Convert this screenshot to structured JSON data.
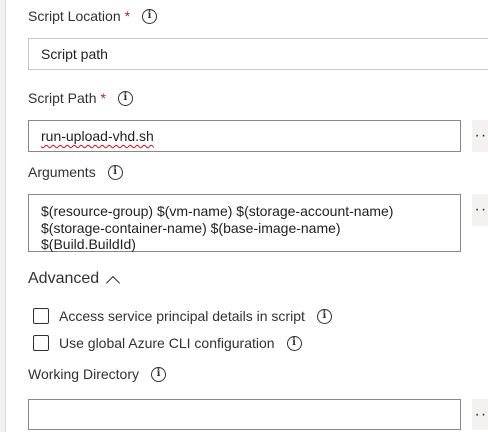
{
  "script_location": {
    "label": "Script Location",
    "required_mark": "*",
    "value": "Script path"
  },
  "script_path": {
    "label": "Script Path",
    "required_mark": "*",
    "value": "run-upload-vhd.sh"
  },
  "arguments": {
    "label": "Arguments",
    "value": "$(resource-group) $(vm-name) $(storage-account-name)\n$(storage-container-name) $(base-image-name)\n$(Build.BuildId)"
  },
  "advanced": {
    "label": "Advanced",
    "options": [
      {
        "label": "Access service principal details in script",
        "checked": false
      },
      {
        "label": "Use global Azure CLI configuration",
        "checked": false
      }
    ]
  },
  "working_directory": {
    "label": "Working Directory",
    "value": ""
  },
  "icons": {
    "info": "info-icon",
    "more": "more-ellipsis-icon",
    "chevron_up": "chevron-up-icon",
    "chevron_down": "chevron-down-icon"
  },
  "ellipsis_glyph": "···",
  "info_glyph": "i",
  "chevron_down_glyph": "▼"
}
